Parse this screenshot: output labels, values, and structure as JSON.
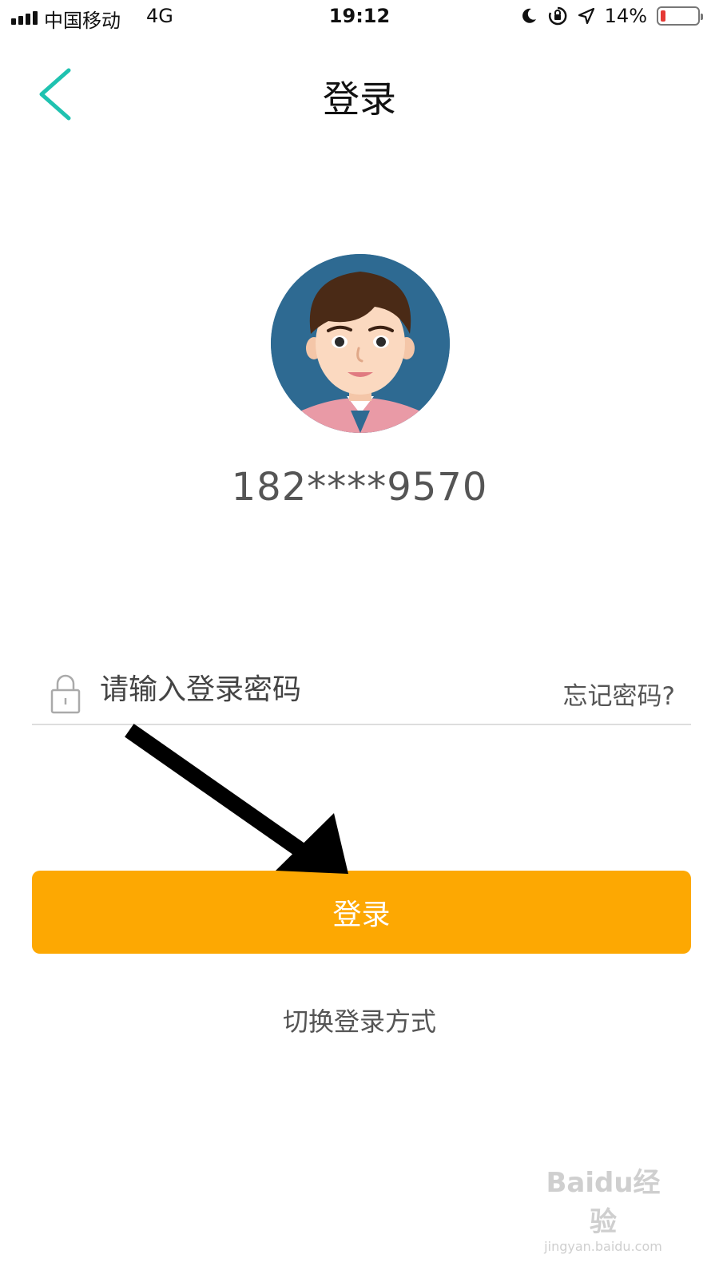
{
  "status_bar": {
    "carrier": "中国移动",
    "network": "4G",
    "time": "19:12",
    "battery_text": "14%",
    "battery_level": 0.14,
    "icons": [
      "signal-icon",
      "moon-icon",
      "rotation-lock-icon",
      "location-icon",
      "battery-icon"
    ]
  },
  "nav": {
    "back_icon": "back-chevron-icon",
    "title": "登录"
  },
  "account": {
    "avatar_icon": "user-avatar",
    "phone": "182****9570"
  },
  "password": {
    "lock_icon": "lock-icon",
    "placeholder": "请输入登录密码",
    "value": "",
    "forgot_label": "忘记密码?"
  },
  "actions": {
    "login_label": "登录",
    "switch_label": "切换登录方式"
  },
  "colors": {
    "accent_teal": "#1fc2b0",
    "button_orange": "#fda802",
    "battery_red": "#e53935"
  },
  "watermark": {
    "logo_text": "Baidu经验",
    "url": "jingyan.baidu.com"
  }
}
